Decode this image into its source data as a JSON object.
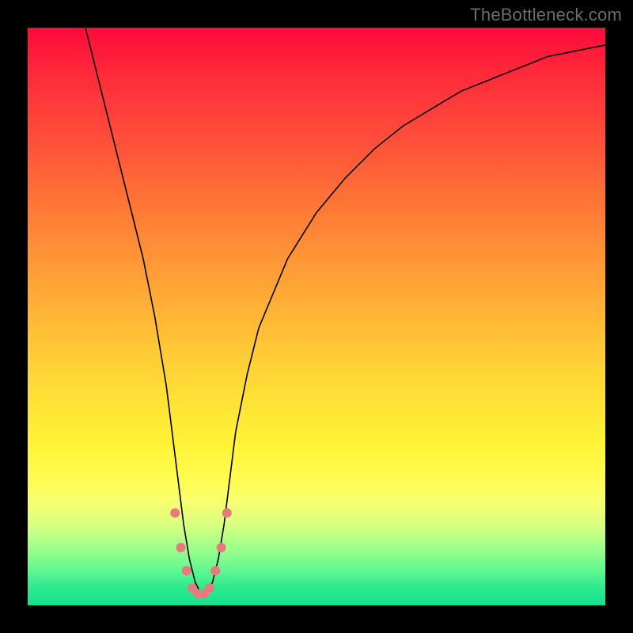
{
  "watermark": "TheBottleneck.com",
  "chart_data": {
    "type": "line",
    "title": "",
    "xlabel": "",
    "ylabel": "",
    "xlim": [
      0,
      100
    ],
    "ylim": [
      0,
      100
    ],
    "grid": false,
    "legend": false,
    "series": [
      {
        "name": "curve",
        "x": [
          10,
          12,
          14,
          16,
          18,
          20,
          22,
          24,
          25,
          26,
          27,
          28,
          29,
          30,
          31,
          32,
          33,
          34,
          35,
          36,
          38,
          40,
          45,
          50,
          55,
          60,
          65,
          70,
          75,
          80,
          85,
          90,
          95,
          100
        ],
        "y": [
          100,
          92,
          84,
          76,
          68,
          60,
          50,
          38,
          30,
          22,
          14,
          8,
          4,
          2,
          2,
          4,
          8,
          14,
          22,
          30,
          40,
          48,
          60,
          68,
          74,
          79,
          83,
          86,
          89,
          91,
          93,
          95,
          96,
          97
        ]
      }
    ],
    "markers": {
      "series": "curve",
      "points_x": [
        25.5,
        26.5,
        27.5,
        28.5,
        29.5,
        30.5,
        31.5,
        32.5,
        33.5,
        34.5
      ],
      "points_y": [
        16,
        10,
        6,
        3,
        2,
        2,
        3,
        6,
        10,
        16
      ],
      "radius": 6,
      "color": "#e77a7a"
    },
    "color_gradient_vertical": [
      {
        "pos": 0.0,
        "color": "#ff0a3a"
      },
      {
        "pos": 0.3,
        "color": "#ff7436"
      },
      {
        "pos": 0.6,
        "color": "#ffd636"
      },
      {
        "pos": 0.78,
        "color": "#fffc50"
      },
      {
        "pos": 0.9,
        "color": "#a0ff8c"
      },
      {
        "pos": 1.0,
        "color": "#16e28e"
      }
    ]
  }
}
